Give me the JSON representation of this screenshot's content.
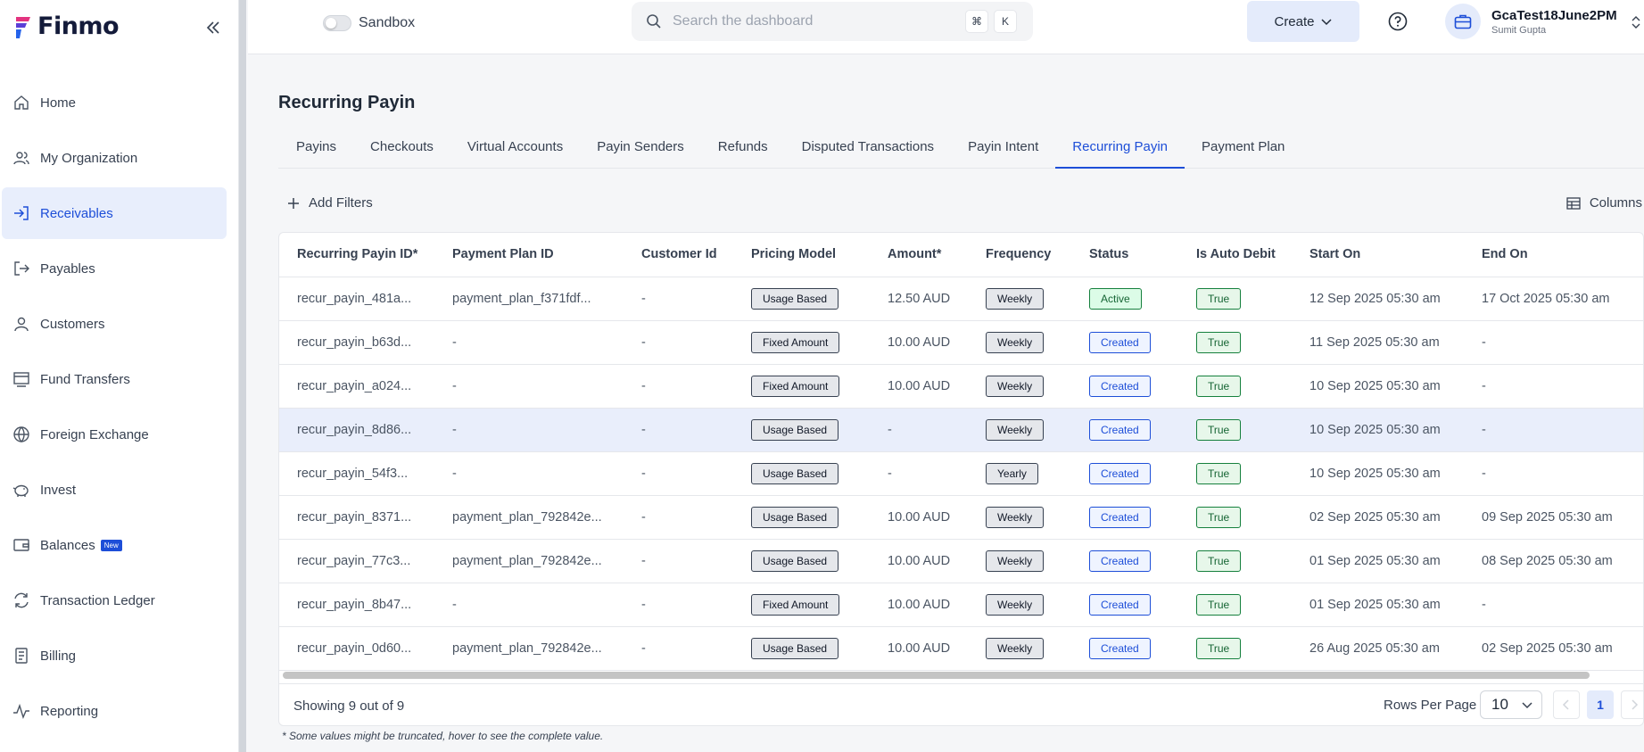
{
  "brand": {
    "name": "Finmo"
  },
  "sidebar": {
    "items": [
      {
        "label": "Home",
        "icon": "home-icon"
      },
      {
        "label": "My Organization",
        "icon": "users-icon"
      },
      {
        "label": "Receivables",
        "icon": "login-arrow-icon",
        "active": true
      },
      {
        "label": "Payables",
        "icon": "logout-arrow-icon"
      },
      {
        "label": "Customers",
        "icon": "user-icon"
      },
      {
        "label": "Fund Transfers",
        "icon": "transfer-icon"
      },
      {
        "label": "Foreign Exchange",
        "icon": "globe-icon"
      },
      {
        "label": "Invest",
        "icon": "piggy-bank-icon"
      },
      {
        "label": "Balances",
        "icon": "wallet-icon",
        "badge": "New"
      },
      {
        "label": "Transaction Ledger",
        "icon": "refresh-icon"
      },
      {
        "label": "Billing",
        "icon": "document-icon"
      },
      {
        "label": "Reporting",
        "icon": "activity-icon"
      }
    ]
  },
  "topbar": {
    "sandbox_label": "Sandbox",
    "search_placeholder": "Search the dashboard",
    "kbd_cmd": "⌘",
    "kbd_k": "K",
    "create_label": "Create",
    "org_name": "GcaTest18June2PM",
    "org_user": "Sumit Gupta"
  },
  "page": {
    "title": "Recurring Payin",
    "tabs": [
      "Payins",
      "Checkouts",
      "Virtual Accounts",
      "Payin Senders",
      "Refunds",
      "Disputed Transactions",
      "Payin Intent",
      "Recurring Payin",
      "Payment Plan"
    ],
    "active_tab": "Recurring Payin",
    "add_filters": "Add Filters",
    "columns": "Columns"
  },
  "table": {
    "headers": [
      "Recurring Payin ID*",
      "Payment Plan ID",
      "Customer Id",
      "Pricing Model",
      "Amount*",
      "Frequency",
      "Status",
      "Is Auto Debit",
      "Start On",
      "End On"
    ],
    "rows": [
      [
        "recur_payin_481a...",
        "payment_plan_f371fdf...",
        "-",
        "Usage Based",
        "12.50 AUD",
        "Weekly",
        "Active",
        "True",
        "12 Sep 2025 05:30 am",
        "17 Oct 2025 05:30 am"
      ],
      [
        "recur_payin_b63d...",
        "-",
        "-",
        "Fixed Amount",
        "10.00 AUD",
        "Weekly",
        "Created",
        "True",
        "11 Sep 2025 05:30 am",
        "-"
      ],
      [
        "recur_payin_a024...",
        "-",
        "-",
        "Fixed Amount",
        "10.00 AUD",
        "Weekly",
        "Created",
        "True",
        "10 Sep 2025 05:30 am",
        "-"
      ],
      [
        "recur_payin_8d86...",
        "-",
        "-",
        "Usage Based",
        "-",
        "Weekly",
        "Created",
        "True",
        "10 Sep 2025 05:30 am",
        "-"
      ],
      [
        "recur_payin_54f3...",
        "-",
        "-",
        "Usage Based",
        "-",
        "Yearly",
        "Created",
        "True",
        "10 Sep 2025 05:30 am",
        "-"
      ],
      [
        "recur_payin_8371...",
        "payment_plan_792842e...",
        "-",
        "Usage Based",
        "10.00 AUD",
        "Weekly",
        "Created",
        "True",
        "02 Sep 2025 05:30 am",
        "09 Sep 2025 05:30 am"
      ],
      [
        "recur_payin_77c3...",
        "payment_plan_792842e...",
        "-",
        "Usage Based",
        "10.00 AUD",
        "Weekly",
        "Created",
        "True",
        "01 Sep 2025 05:30 am",
        "08 Sep 2025 05:30 am"
      ],
      [
        "recur_payin_8b47...",
        "-",
        "-",
        "Fixed Amount",
        "10.00 AUD",
        "Weekly",
        "Created",
        "True",
        "01 Sep 2025 05:30 am",
        "-"
      ],
      [
        "recur_payin_0d60...",
        "payment_plan_792842e...",
        "-",
        "Usage Based",
        "10.00 AUD",
        "Weekly",
        "Created",
        "True",
        "26 Aug 2025 05:30 am",
        "02 Sep 2025 05:30 am"
      ]
    ],
    "highlighted_row": 3
  },
  "footer": {
    "showing": "Showing 9 out of 9",
    "rows_per_page_label": "Rows Per Page",
    "rows_per_page_value": "10",
    "current_page": "1",
    "note": "* Some values might be truncated, hover to see the complete value."
  },
  "colors": {
    "accent": "#1d4ed8",
    "brand_dark": "#141b3a",
    "active_nav_bg": "#e8eefc"
  }
}
